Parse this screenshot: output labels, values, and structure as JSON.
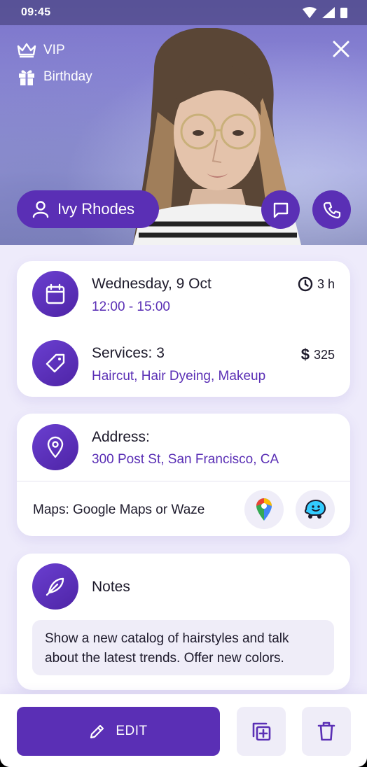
{
  "status_bar": {
    "time": "09:45"
  },
  "hero": {
    "tags": [
      {
        "label": "VIP",
        "icon": "crown-icon"
      },
      {
        "label": "Birthday",
        "icon": "gift-icon"
      }
    ],
    "client_name": "Ivy Rhodes"
  },
  "appointment": {
    "date": "Wednesday, 9 Oct",
    "time_range": "12:00 - 15:00",
    "duration": "3 h",
    "services_title": "Services: 3",
    "services_list": "Haircut, Hair Dyeing, Makeup",
    "price": "325",
    "currency_symbol": "$"
  },
  "address": {
    "title": "Address:",
    "value": "300 Post St, San Francisco, CA",
    "maps_label": "Maps: Google Maps or Waze"
  },
  "notes": {
    "title": "Notes",
    "text": "Show a new catalog of hairstyles and talk about the latest trends. Offer new colors."
  },
  "actions": {
    "edit_label": "EDIT"
  },
  "colors": {
    "accent": "#5a2fb5",
    "background": "#eeebfb",
    "soft_button": "#efedf8"
  }
}
